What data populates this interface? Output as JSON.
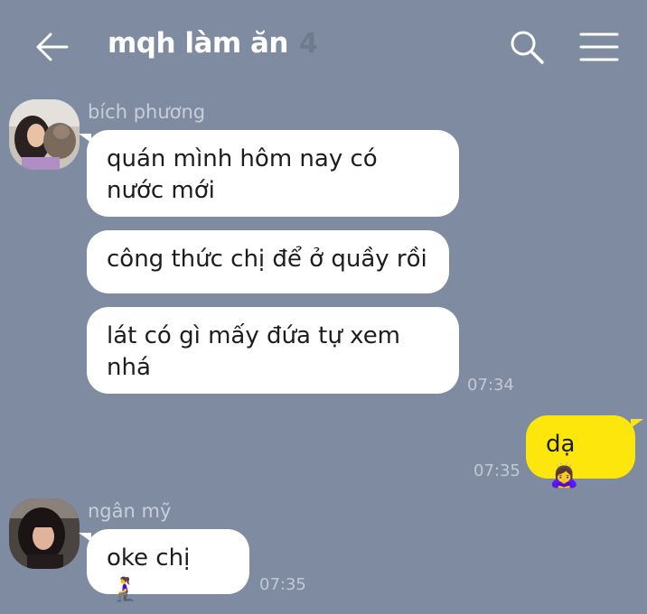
{
  "header": {
    "title": "mqh làm ăn",
    "member_count": "4",
    "icons": {
      "back": "arrow-left-icon",
      "search": "search-icon",
      "menu": "hamburger-menu-icon"
    }
  },
  "messages": [
    {
      "sender": "bích phương",
      "bubbles": [
        "quán mình hôm nay có nước mới",
        "công thức chị để ở quầy rồi",
        "lát có gì mấy đứa tự xem nhá"
      ],
      "time": "07:34"
    },
    {
      "self": true,
      "text": "dạ",
      "emoji": "🙇‍♀️",
      "time": "07:35"
    },
    {
      "sender": "ngân mỹ",
      "text": "oke chị",
      "emoji": "🧎‍♀️",
      "time": "07:35"
    }
  ],
  "colors": {
    "background": "#7f8ba0",
    "bubble_other": "#ffffff",
    "bubble_self": "#fde60b",
    "title": "#ffffff"
  }
}
